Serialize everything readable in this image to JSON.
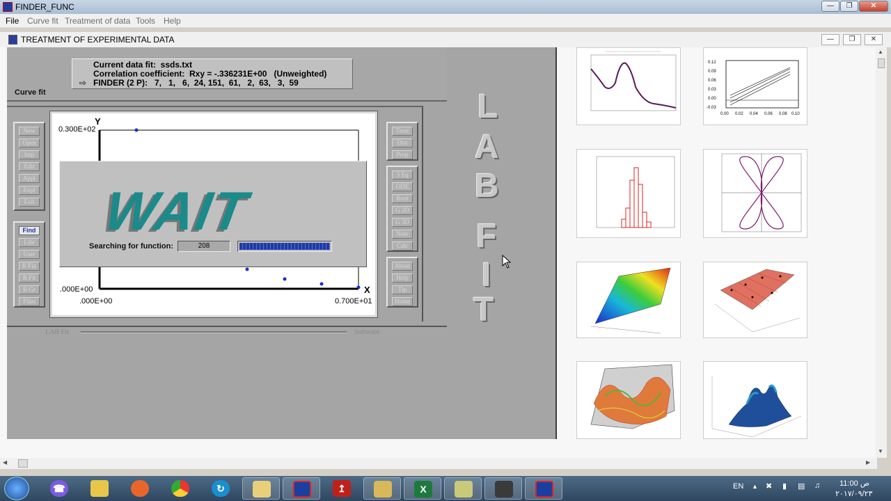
{
  "app": {
    "title": "FINDER_FUNC"
  },
  "menu": [
    "File",
    "Curve fit",
    "Treatment of data",
    "Tools",
    "Help"
  ],
  "window": {
    "title": "TREATMENT OF EXPERIMENTAL DATA"
  },
  "info": {
    "line1": "Current data fit:  ssds.txt",
    "line2": "Correlation coefficient:  Rxy = -.336231E+00   (Unweighted)",
    "line3": "FINDER (2 P):   7,   1,   6,  24, 151,  61,   2,  63,   3,  59",
    "section_label": "Curve fit"
  },
  "left_buttons": [
    "New",
    "Open",
    "Imp",
    "Edit",
    "Appl",
    "Expl",
    "Exit"
  ],
  "mid_buttons": [
    "Find",
    "Libr",
    "User",
    "R Fin",
    "R Fit",
    "R Gr",
    "Files"
  ],
  "right_buttons_top": [
    "Treat",
    "Dist",
    "Prop"
  ],
  "right_buttons_mid": [
    "3 Eq",
    "ODE",
    "Root",
    "G 2D",
    "G 3D",
    "Note",
    "Calc"
  ],
  "right_buttons_bot": [
    "About",
    "Help",
    "Tip",
    "Home"
  ],
  "plot": {
    "y_axis": "Y",
    "x_axis": "X",
    "y_max_label": "0.300E+02",
    "y_min_label": ".000E+00",
    "x_min_label": ".000E+00",
    "x_max_label": "0.700E+01"
  },
  "wait": {
    "title": "WAIT",
    "search_label": "Searching for function:",
    "count": "208",
    "progress": 1.0
  },
  "bottom": {
    "left": "LAB Fit",
    "right": "Software"
  },
  "brand_letters": [
    "L",
    "A",
    "B",
    "F",
    "I",
    "T"
  ],
  "gallery": [
    {
      "name": "spectrum-plot"
    },
    {
      "name": "linear-fits-plot",
      "y_ticks": [
        "0.12",
        "0.09",
        "0.06",
        "0.03",
        "0.00",
        "-0.03"
      ],
      "x_ticks": [
        "0.00",
        "0.02",
        "0.04",
        "0.06",
        "0.08",
        "0.10"
      ]
    },
    {
      "name": "histogram-plot"
    },
    {
      "name": "four-petal-polar-plot"
    },
    {
      "name": "color-surface-plot"
    },
    {
      "name": "3d-fit-surface-plot"
    },
    {
      "name": "3d-wire-surface-plot"
    },
    {
      "name": "3d-peaks-plot"
    }
  ],
  "tray": {
    "lang": "EN",
    "time": "11:00 ص",
    "date": "٢٠١٧/٠٩/٢٣"
  }
}
